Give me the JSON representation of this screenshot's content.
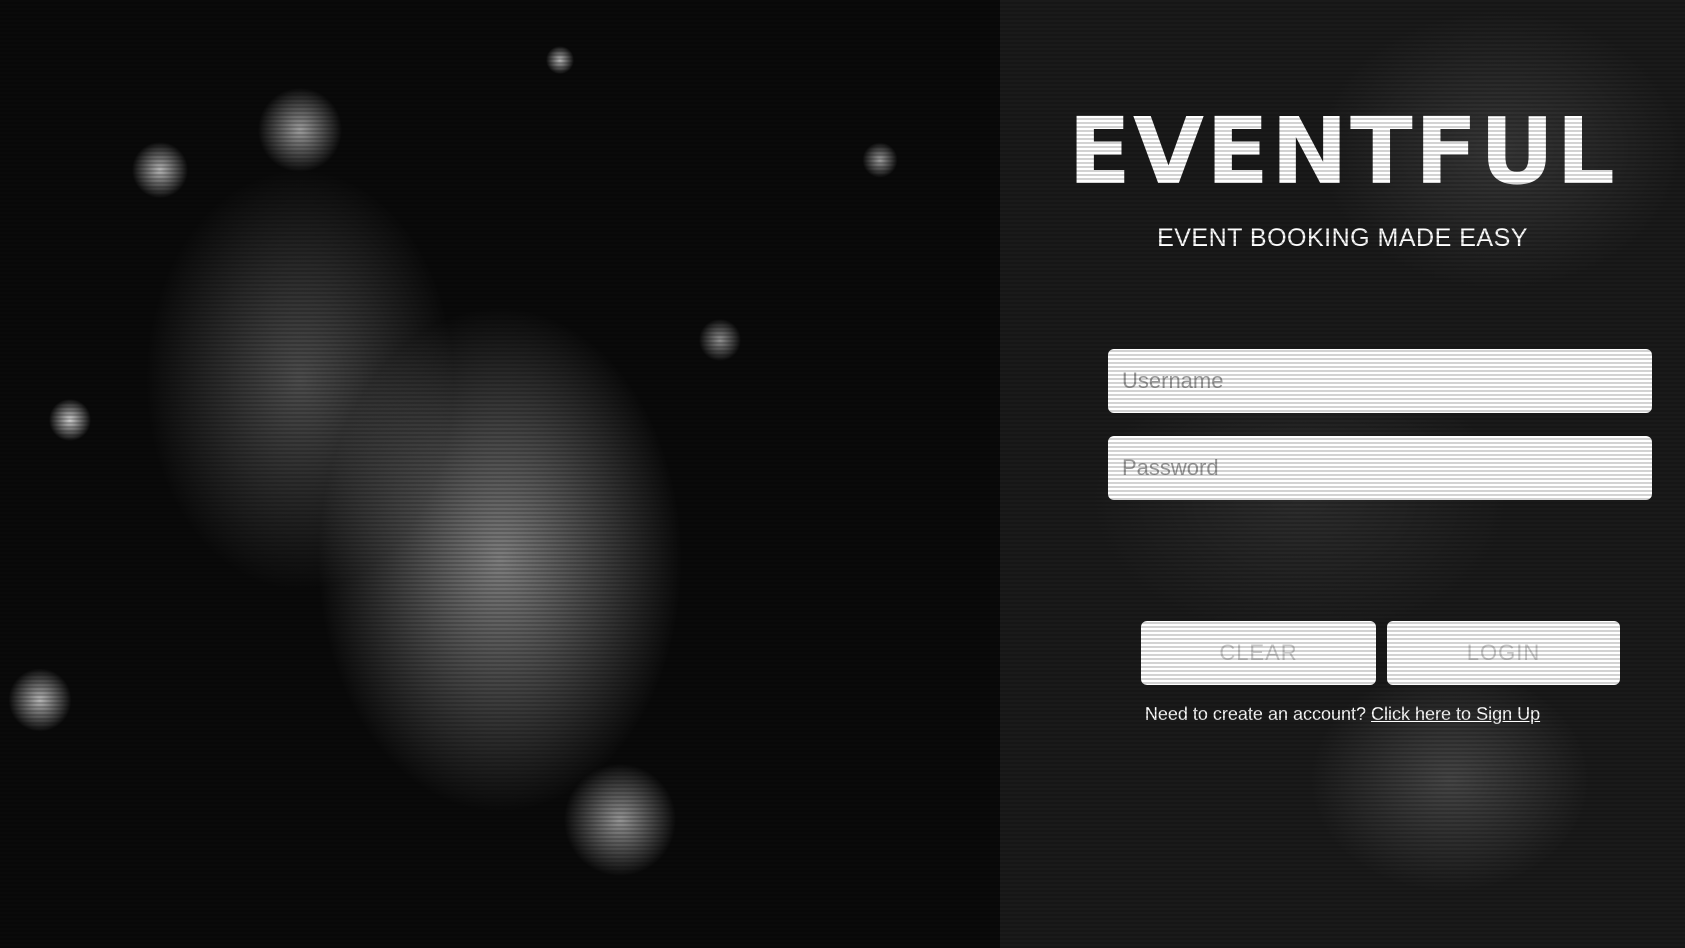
{
  "brand": {
    "title": "EVENTFUL",
    "tagline": "EVENT BOOKING MADE EASY"
  },
  "login_form": {
    "username_placeholder": "Username",
    "password_placeholder": "Password",
    "clear_label": "CLEAR",
    "login_label": "LOGIN"
  },
  "signup": {
    "prompt": "Need to create an account?",
    "link_label": "Click here to Sign Up"
  },
  "colors": {
    "background": "#000000",
    "panel": "#1a1a1a",
    "text": "#ffffff",
    "input_bg": "#ffffff",
    "button_text": "#c9c9c9"
  }
}
